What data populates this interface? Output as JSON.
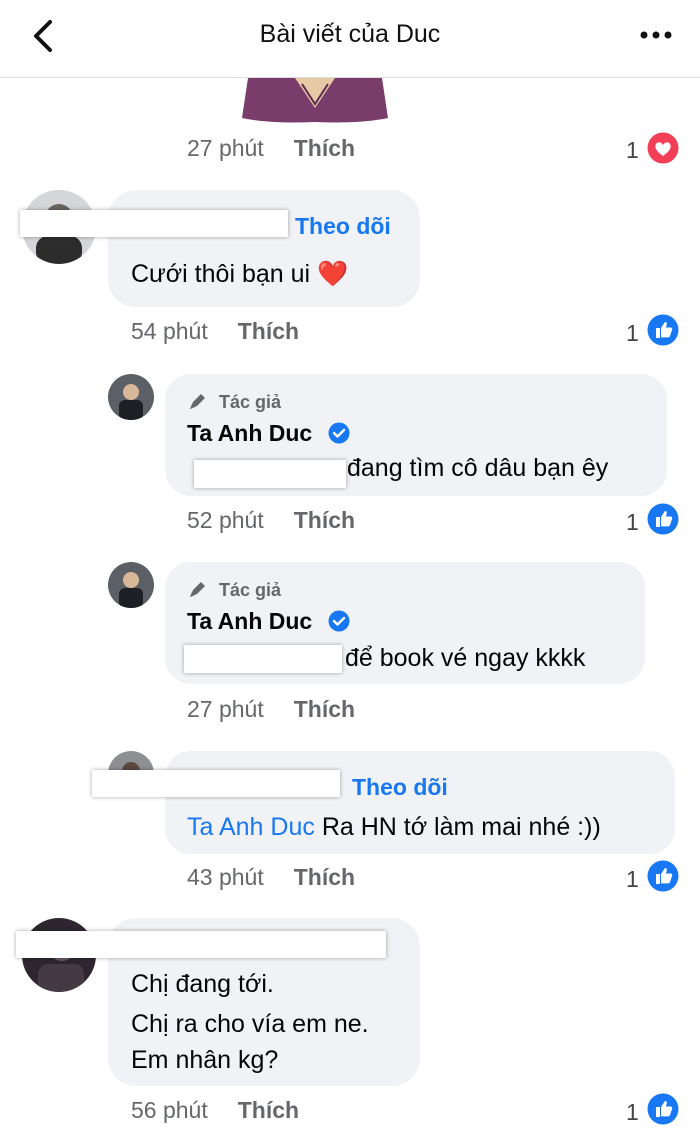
{
  "header": {
    "title": "Bài viết của Duc"
  },
  "top": {
    "time": "27 phút",
    "like": "Thích",
    "count": "1"
  },
  "c1": {
    "follow": "Theo dõi",
    "text": "Cưới thôi bạn ui ❤️",
    "time": "54 phút",
    "like": "Thích",
    "count": "1"
  },
  "c2": {
    "author_label": "Tác giả",
    "name": "Ta Anh Duc",
    "text": "đang tìm cô dâu bạn êy",
    "time": "52 phút",
    "like": "Thích",
    "count": "1"
  },
  "c3": {
    "author_label": "Tác giả",
    "name": "Ta Anh Duc",
    "text": "để book vé ngay kkkk",
    "time": "27 phút",
    "like": "Thích"
  },
  "c4": {
    "follow": "Theo dõi",
    "tag": "Ta Anh Duc",
    "text": "Ra HN tớ làm mai nhé :))",
    "time": "43 phút",
    "like": "Thích",
    "count": "1"
  },
  "c5": {
    "line1": "Chị đang tới.",
    "line2": "Chị ra cho vía em ne.",
    "line3": "Em nhân kg?",
    "time": "56 phút",
    "like": "Thích",
    "count": "1"
  },
  "colors": {
    "accent": "#1877f2",
    "bubble": "#f0f2f5",
    "heart": "#f33e58"
  }
}
